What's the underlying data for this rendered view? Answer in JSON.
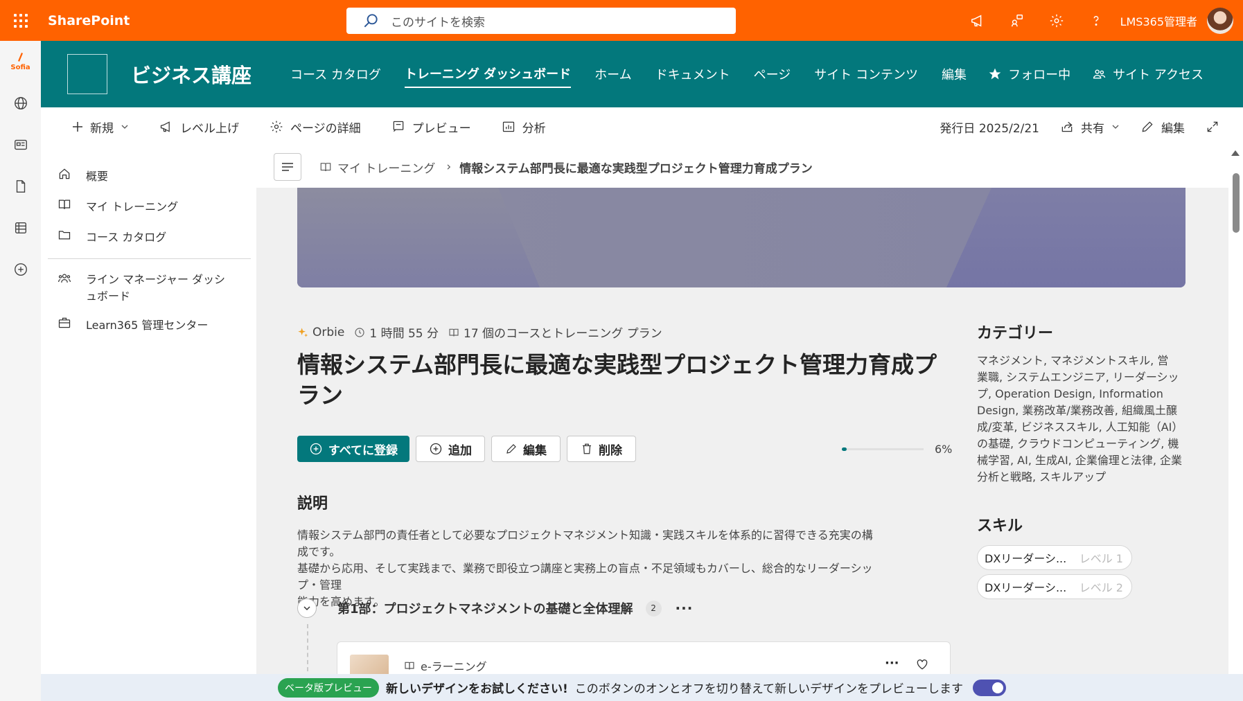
{
  "app": {
    "name": "SharePoint"
  },
  "search": {
    "placeholder": "このサイトを検索"
  },
  "user": {
    "name": "LMS365管理者"
  },
  "rail": {
    "sofia_label": "Sofia"
  },
  "site": {
    "title": "ビジネス講座",
    "nav": [
      "コース カタログ",
      "トレーニング ダッシュボード",
      "ホーム",
      "ドキュメント",
      "ページ",
      "サイト コンテンツ",
      "編集"
    ],
    "active_nav": "トレーニング ダッシュボード",
    "follow_label": "フォロー中",
    "access_label": "サイト アクセス"
  },
  "commandbar": {
    "new": "新規",
    "promote": "レベル上げ",
    "page_details": "ページの詳細",
    "preview": "プレビュー",
    "analytics": "分析",
    "published": "発行日 2025/2/21",
    "share": "共有",
    "edit": "編集"
  },
  "leftnav": {
    "overview": "概要",
    "my_training": "マイ トレーニング",
    "course_catalog": "コース カタログ",
    "manager_dashboard_l1": "ライン マネージャー ダッシ",
    "manager_dashboard_l2": "ュボード",
    "admin_center": "Learn365 管理センター"
  },
  "breadcrumb": {
    "root": "マイ トレーニング",
    "current": "情報システム部門長に最適な実践型プロジェクト管理力育成プラン"
  },
  "plan": {
    "author": "Orbie",
    "duration": "1 時間 55 分",
    "courses": "17 個のコースとトレーニング プラン",
    "title_l1": "情報システム部門長に最適な実践型プロジェクト管理力育成プ",
    "title_l2": "ラン",
    "enroll_all": "すべてに登録",
    "add": "追加",
    "edit": "編集",
    "delete": "削除",
    "progress_pct": 6,
    "progress_label": "6%",
    "description_heading": "説明",
    "description_l1": "情報システム部門の責任者として必要なプロジェクトマネジメント知識・実践スキルを体系的に習得できる充実の構成です。",
    "description_l2": "基礎から応用、そして実践まで、業務で即役立つ講座と実務上の盲点・不足領域もカバーし、総合的なリーダーシップ・管理",
    "description_l3": "能力を高めます。"
  },
  "part1": {
    "title": "第1部：プロジェクトマネジメントの基礎と全体理解",
    "count": "2",
    "card_type": "e-ラーニング"
  },
  "category": {
    "heading": "カテゴリー",
    "lines": [
      "マネジメント, マネジメントスキル, 営",
      "業職, システムエンジニア, リーダーシッ",
      "プ, Operation Design, Information",
      "Design, 業務改革/業務改善, 組織風土醸",
      "成/変革, ビジネススキル, 人工知能（AI）",
      "の基礎, クラウドコンピューティング, 機",
      "械学習, AI, 生成AI, 企業倫理と法律, 企業",
      "分析と戦略, スキルアップ"
    ]
  },
  "skills": {
    "heading": "スキル",
    "items": [
      {
        "name": "DXリーダーシ...",
        "level": "レベル 1"
      },
      {
        "name": "DXリーダーシ...",
        "level": "レベル 2"
      }
    ]
  },
  "banner": {
    "beta": "ベータ版プレビュー",
    "bold": "新しいデザインをお試しください!",
    "text": "このボタンのオンとオフを切り替えて新しいデザインをプレビューします",
    "toggle_on": true
  },
  "colors": {
    "suite_bar": "#ff6200",
    "hub_bar": "#03787c",
    "accent": "#03787c",
    "toggle": "#4f52b2",
    "beta": "#2aa351"
  }
}
